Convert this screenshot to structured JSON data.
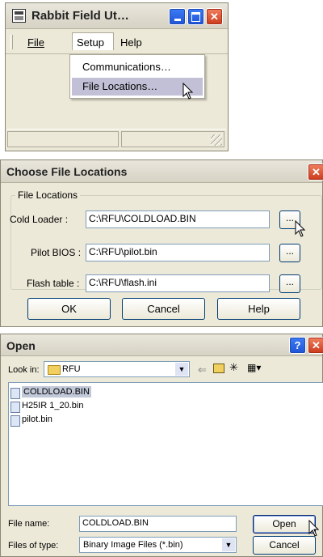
{
  "app_window": {
    "title": "Rabbit Field Ut…",
    "menu": {
      "file": "File",
      "setup": "Setup",
      "help": "Help"
    },
    "setup_menu": {
      "item1": "Communications…",
      "item2": "File Locations…"
    }
  },
  "file_locations_dialog": {
    "title": "Choose File Locations",
    "group_label": "File Locations",
    "rows": [
      {
        "label": "Cold Loader :",
        "value": "C:\\RFU\\COLDLOAD.BIN",
        "browse": "..."
      },
      {
        "label": "Pilot BIOS :",
        "value": "C:\\RFU\\pilot.bin",
        "browse": "..."
      },
      {
        "label": "Flash table :",
        "value": "C:\\RFU\\flash.ini",
        "browse": "..."
      }
    ],
    "buttons": {
      "ok": "OK",
      "cancel": "Cancel",
      "help": "Help"
    }
  },
  "open_dialog": {
    "title": "Open",
    "look_in_label": "Look in:",
    "look_in_value": "RFU",
    "files": [
      "COLDLOAD.BIN",
      "H25IR 1_20.bin",
      "pilot.bin"
    ],
    "file_name_label": "File name:",
    "file_name_value": "COLDLOAD.BIN",
    "files_of_type_label": "Files of type:",
    "files_of_type_value": "Binary Image Files (*.bin)",
    "open_button": "Open",
    "cancel_button": "Cancel",
    "help_glyph": "?"
  }
}
